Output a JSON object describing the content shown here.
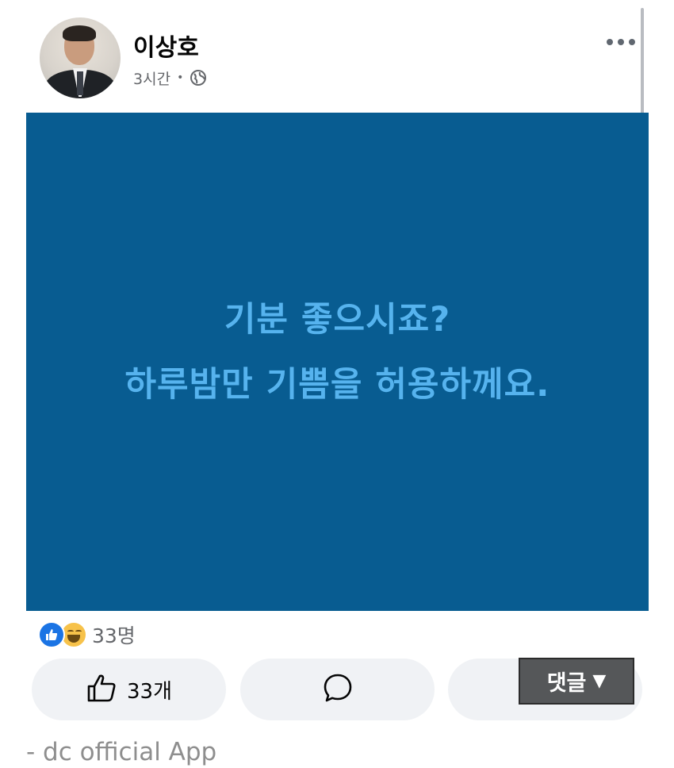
{
  "post": {
    "author_name": "이상호",
    "timestamp": "3시간",
    "separator": "•",
    "privacy_icon": "globe-icon",
    "more_icon": "more-horizontal-icon"
  },
  "image": {
    "background": "#085c91",
    "text_color": "#56b3ee",
    "lines": [
      "기분 좋으시죠?",
      "하루밤만 기쁨을 허용하께요."
    ]
  },
  "reactions": {
    "icons": [
      "like-reaction-icon",
      "haha-reaction-icon"
    ],
    "count": "33명"
  },
  "actions": {
    "like_label": "33개",
    "like_icon": "thumbs-up-icon",
    "comment_icon": "comment-bubble-icon"
  },
  "overlay": {
    "label": "댓글",
    "arrow": "▼"
  },
  "footer": {
    "source": "- dc official App"
  },
  "colors": {
    "like_blue": "#1b74e4",
    "button_bg": "#f0f2f5",
    "meta_gray": "#65676b"
  }
}
